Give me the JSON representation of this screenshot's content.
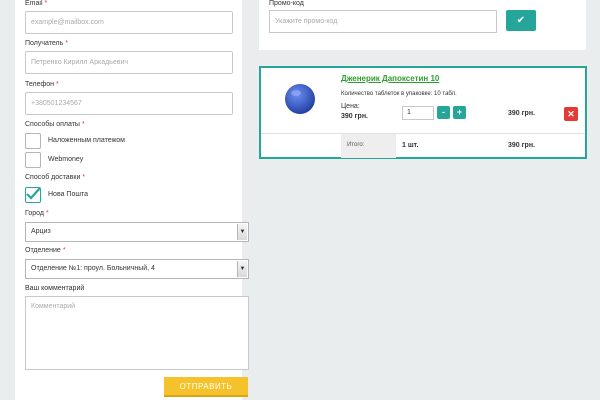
{
  "form": {
    "email": {
      "label": "Email",
      "required": "*",
      "placeholder": "example@mailbox.com"
    },
    "recipient": {
      "label": "Получатель",
      "required": "*",
      "placeholder": "Петренко Кирилл Аркадьевич"
    },
    "phone": {
      "label": "Телефон",
      "required": "*",
      "placeholder": "+380501234567"
    },
    "payment": {
      "label": "Способы оплаты",
      "required": "*",
      "options": [
        "Наложенным платежом",
        "Webmoney"
      ]
    },
    "delivery": {
      "label": "Способ доставки",
      "required": "*",
      "options": [
        "Нова Пошта"
      ]
    },
    "city": {
      "label": "Город",
      "required": "*",
      "value": "Арциз"
    },
    "branch": {
      "label": "Отделение",
      "required": "*",
      "value": "Отделение №1: проул. Больничный, 4"
    },
    "comment": {
      "label": "Ваш комментарий",
      "placeholder": "Комментарий"
    },
    "submit_label": "ОТПРАВИТЬ"
  },
  "promo": {
    "label": "Промо-код",
    "placeholder": "Укажите промо-код",
    "apply_icon": "check-icon"
  },
  "cart": {
    "product_name": "Дженерик Дапоксетин 10",
    "description": "Количество таблеток в упаковке: 10 табл.",
    "price_label": "Цена:",
    "price_value": "390 грн.",
    "quantity": "1",
    "minus_label": "-",
    "plus_label": "+",
    "line_total": "390 грн.",
    "remove_icon": "close-icon",
    "total_label": "Итого:",
    "total_qty": "1 шт.",
    "total_sum": "390 грн."
  },
  "colors": {
    "accent": "#26a69a",
    "submit": "#f6c22b",
    "remove": "#e53935",
    "product_link": "#2e9e2e",
    "background": "#e9edee"
  }
}
